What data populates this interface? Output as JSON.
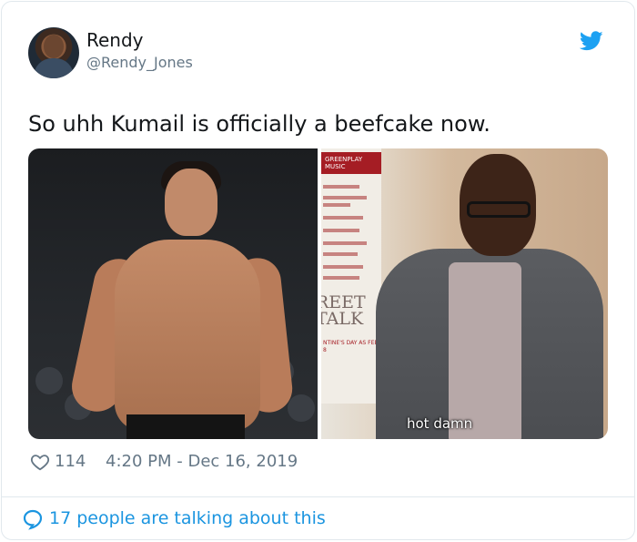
{
  "tweet": {
    "author_name": "Rendy",
    "author_handle": "@Rendy_Jones",
    "text": "So uhh Kumail is officially a beefcake now.",
    "likes": "114",
    "timestamp": "4:20 PM - Dec 16, 2019",
    "media_caption": "hot damn",
    "talking": "17 people are talking about this",
    "poster_text": {
      "banner": "GREENPLAY MUSIC",
      "big": "REET TALK",
      "tiny": "NTINE'S DAY AS FEB 8"
    }
  },
  "icons": {
    "bird": "twitter-bird-icon",
    "heart": "heart-outline-icon",
    "bubble": "speech-bubble-icon"
  },
  "colors": {
    "brand": "#1da1f2",
    "link": "#1b95e0",
    "secondary_text": "#657786",
    "border": "#e1e8ed"
  }
}
